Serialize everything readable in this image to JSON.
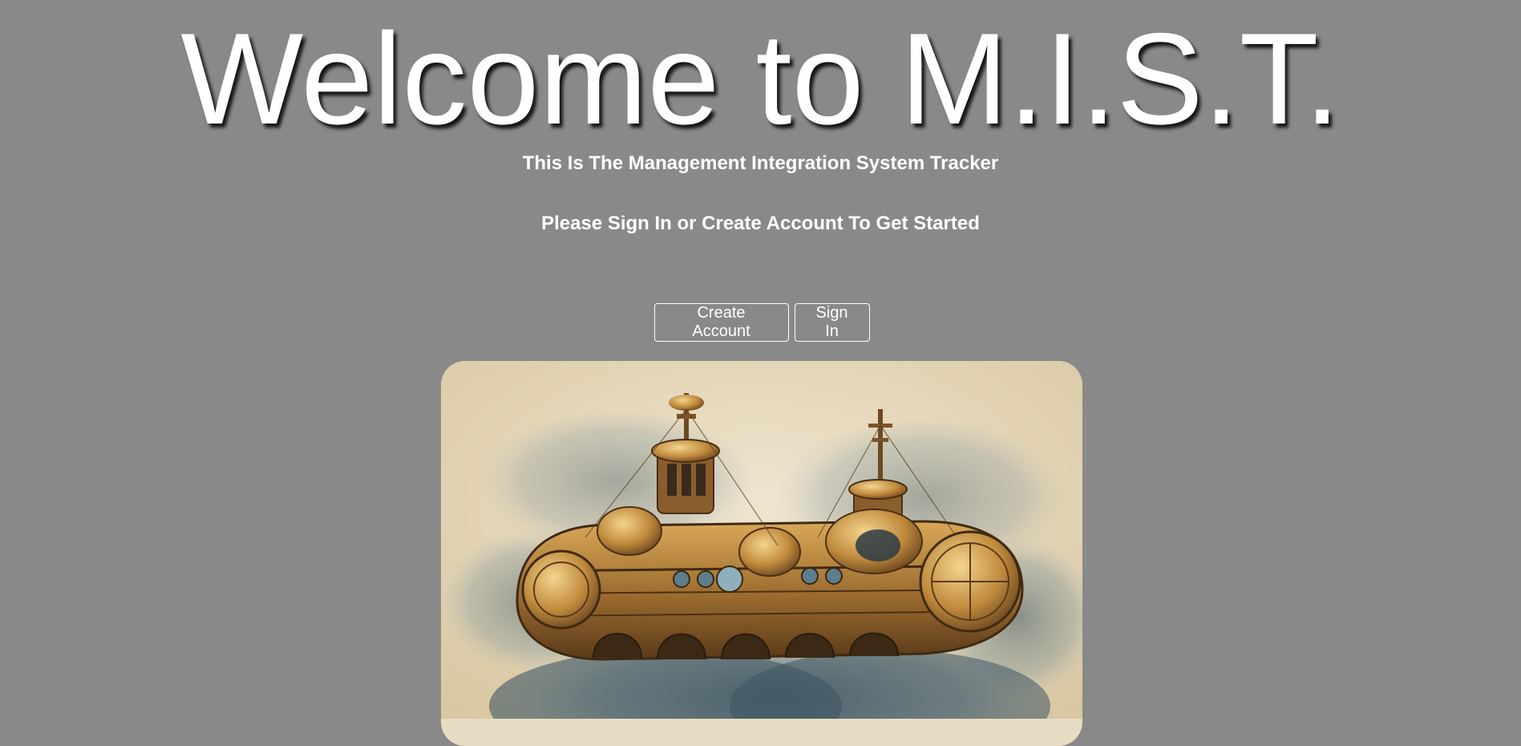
{
  "page": {
    "title": "Welcome to M.I.S.T.",
    "subtitle": "This Is The Management Integration System Tracker",
    "prompt": "Please Sign In or Create Account To Get Started"
  },
  "buttons": {
    "create_account": "Create Account",
    "sign_in": "Sign In"
  },
  "hero": {
    "image_name": "steampunk-airship-illustration-icon"
  },
  "colors": {
    "background": "#898989",
    "text": "#ffffff",
    "paper": "#e8dcc2",
    "brass": "#b8863a",
    "smoke": "#5f7a88"
  }
}
